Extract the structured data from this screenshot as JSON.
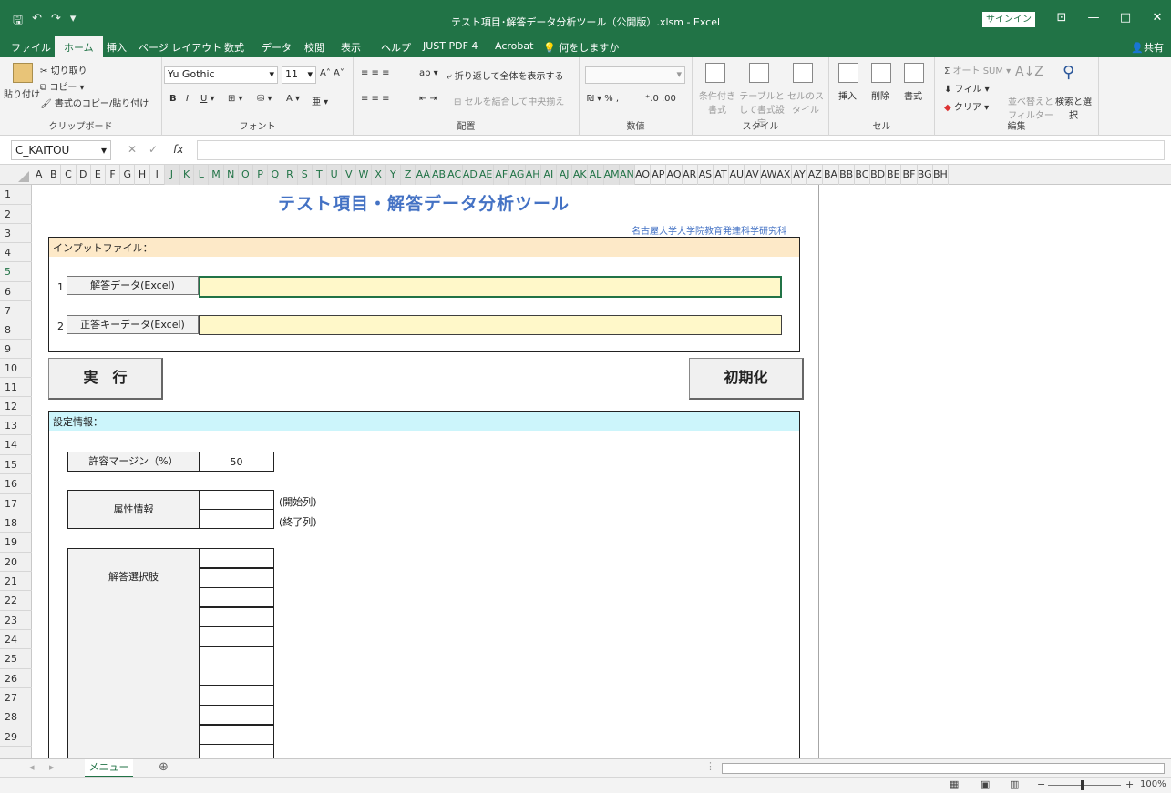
{
  "titlebar": {
    "title": "テスト項目･解答データ分析ツール（公開版）.xlsm  -  Excel",
    "signin": "サインイン",
    "minimize": "—",
    "restore": "□",
    "close": "✕"
  },
  "tabs": [
    {
      "label": "ファイル"
    },
    {
      "label": "ホーム"
    },
    {
      "label": "挿入"
    },
    {
      "label": "ページ レイアウト"
    },
    {
      "label": "数式"
    },
    {
      "label": "データ"
    },
    {
      "label": "校閲"
    },
    {
      "label": "表示"
    },
    {
      "label": "ヘルプ"
    },
    {
      "label": "JUST PDF 4"
    },
    {
      "label": "Acrobat"
    },
    {
      "label": "何をしますか"
    }
  ],
  "share": "共有",
  "ribbon": {
    "clipboard": {
      "label": "クリップボード",
      "paste": "貼り付け",
      "cut": "切り取り",
      "copy": "コピー",
      "format_painter": "書式のコピー/貼り付け"
    },
    "font": {
      "label": "フォント",
      "name": "Yu Gothic",
      "size": "11"
    },
    "alignment": {
      "label": "配置",
      "wrap": "折り返して全体を表示する",
      "merge": "セルを結合して中央揃え"
    },
    "number": {
      "label": "数値",
      "percent": "%"
    },
    "styles": {
      "label": "スタイル",
      "conditional": "条件付き書式",
      "table": "テーブルとして書式設定",
      "cell": "セルのスタイル"
    },
    "cells": {
      "label": "セル",
      "insert": "挿入",
      "delete": "削除",
      "format": "書式"
    },
    "editing": {
      "label": "編集",
      "autosum": "オート SUM",
      "fill": "フィル",
      "clear": "クリア",
      "sort": "並べ替えとフィルター",
      "find": "検索と選択"
    }
  },
  "formula": {
    "namebox": "C_KAITOU",
    "fx": "fx",
    "value": ""
  },
  "columns": [
    "A",
    "B",
    "C",
    "D",
    "E",
    "F",
    "G",
    "H",
    "I",
    "J",
    "K",
    "L",
    "M",
    "N",
    "O",
    "P",
    "Q",
    "R",
    "S",
    "T",
    "U",
    "V",
    "W",
    "X",
    "Y",
    "Z",
    "AA",
    "AB",
    "AC",
    "AD",
    "AE",
    "AF",
    "AG",
    "AH",
    "AI",
    "AJ",
    "AK",
    "AL",
    "AM",
    "AN",
    "AO",
    "AP",
    "AQ",
    "AR",
    "AS",
    "AT",
    "AU",
    "AV",
    "AW",
    "AX",
    "AY",
    "AZ",
    "BA",
    "BB",
    "BC",
    "BD",
    "BE",
    "BF",
    "BG",
    "BH"
  ],
  "rows": [
    "1",
    "2",
    "3",
    "4",
    "5",
    "6",
    "7",
    "8",
    "9",
    "10",
    "11",
    "12",
    "13",
    "14",
    "15",
    "16",
    "17",
    "18",
    "19",
    "20",
    "21",
    "22",
    "23",
    "24",
    "25",
    "26",
    "27",
    "28",
    "29"
  ],
  "sheet": {
    "title": "テスト項目・解答データ分析ツール",
    "subtitle": "名古屋大学大学院教育発達科学研究科",
    "input_header": "インプットファイル：",
    "input1_no": "1",
    "input1_btn": "解答データ(Excel)",
    "input1_value": "",
    "input2_no": "2",
    "input2_btn": "正答キーデータ(Excel)",
    "input2_value": "",
    "run": "実　行",
    "reset": "初期化",
    "settings_header": "設定情報：",
    "margin_label": "許容マージン（%）",
    "margin_value": "50",
    "attr_label": "属性情報",
    "attr_start": "(開始列)",
    "attr_end": "(終了列)",
    "choices_label": "解答選択肢"
  },
  "sheettab": "メニュー",
  "status": {
    "zoom": "100%"
  }
}
